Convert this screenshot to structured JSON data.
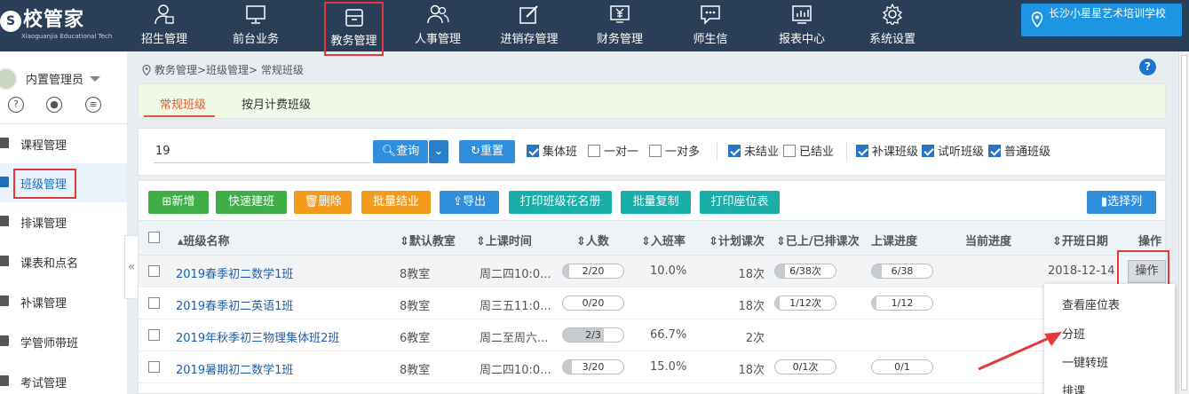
{
  "brand": {
    "name": "校管家",
    "sub": "Xiaoguanjia Educational Tech"
  },
  "nav": [
    {
      "label": "招生管理",
      "icon": "recruit-icon"
    },
    {
      "label": "前台业务",
      "icon": "monitor-icon"
    },
    {
      "label": "教务管理",
      "icon": "archive-icon",
      "active": true
    },
    {
      "label": "人事管理",
      "icon": "people-icon"
    },
    {
      "label": "进销存管理",
      "icon": "edit-icon"
    },
    {
      "label": "财务管理",
      "icon": "finance-icon"
    },
    {
      "label": "师生信",
      "icon": "message-icon"
    },
    {
      "label": "报表中心",
      "icon": "chart-icon"
    },
    {
      "label": "系统设置",
      "icon": "gear-icon"
    }
  ],
  "school": "长沙小星星艺术培训学校",
  "user": {
    "name": "内置管理员"
  },
  "menu": [
    {
      "label": "课程管理",
      "icon": "book-icon"
    },
    {
      "label": "班级管理",
      "icon": "class-icon",
      "selected": true
    },
    {
      "label": "排课管理",
      "icon": "calendar-icon"
    },
    {
      "label": "课表和点名",
      "icon": "checklist-icon"
    },
    {
      "label": "补课管理",
      "icon": "makeup-icon"
    },
    {
      "label": "学管师带班",
      "icon": "teacher-icon"
    },
    {
      "label": "考试管理",
      "icon": "exam-icon"
    }
  ],
  "breadcrumb": "教务管理>班级管理> 常规班级",
  "tabs": [
    "常规班级",
    "按月计费班级"
  ],
  "search": {
    "value": "19",
    "query_label": "查询",
    "reset_label": "重置"
  },
  "filters": [
    {
      "label": "集体班",
      "checked": true
    },
    {
      "label": "一对一",
      "checked": false
    },
    {
      "label": "一对多",
      "checked": false
    },
    {
      "label": "未结业",
      "checked": true
    },
    {
      "label": "已结业",
      "checked": false
    },
    {
      "label": "补课班级",
      "checked": true
    },
    {
      "label": "试听班级",
      "checked": true
    },
    {
      "label": "普通班级",
      "checked": true
    }
  ],
  "actions": {
    "add": "新增",
    "quick": "快速建班",
    "delete": "删除",
    "graduate": "批量结业",
    "export": "导出",
    "print_roster": "打印班级花名册",
    "batch_copy": "批量复制",
    "print_seat": "打印座位表",
    "select_cols": "选择列"
  },
  "columns": [
    "班级名称",
    "默认教室",
    "上课时间",
    "人数",
    "入班率",
    "计划课次",
    "已上/已排课次",
    "上课进度",
    "当前进度",
    "开班日期",
    "操作"
  ],
  "rows": [
    {
      "name": "2019春季初二数学1班",
      "room": "8教室",
      "time": "周二四10:0...",
      "count": "2/20",
      "count_ratio": 0.1,
      "rate": "10.0%",
      "plan": "18次",
      "done": "6/38次",
      "done_ratio": 0.16,
      "progress": "6/38",
      "progress_ratio": 0.16,
      "date": "2018-12-14",
      "op": "操作"
    },
    {
      "name": "2019春季初二英语1班",
      "room": "8教室",
      "time": "周三五11:0...",
      "count": "0/20",
      "count_ratio": 0,
      "rate": "",
      "plan": "18次",
      "done": "1/12次",
      "done_ratio": 0.08,
      "progress": "1/12",
      "progress_ratio": 0.08,
      "date": "",
      "op": ""
    },
    {
      "name": "2019年秋季初三物理集体班2班",
      "room": "6教室",
      "time": "周二至周六...",
      "count": "2/3",
      "count_ratio": 0.67,
      "rate": "66.7%",
      "plan": "2次",
      "done": "",
      "done_ratio": 0,
      "progress": "",
      "progress_ratio": 0,
      "date": "",
      "op": ""
    },
    {
      "name": "2019暑期初二数学1班",
      "room": "8教室",
      "time": "周二四10:0...",
      "count": "3/20",
      "count_ratio": 0.15,
      "rate": "15.0%",
      "plan": "18次",
      "done": "0/1次",
      "done_ratio": 0,
      "progress": "0/1",
      "progress_ratio": 0,
      "date": "",
      "op": ""
    }
  ],
  "dropdown": [
    "查看座位表",
    "分班",
    "一键转班",
    "排课"
  ],
  "colors": {
    "topbar": "#2b3e57",
    "accent": "#1d95e3",
    "highlight": "#e4393c"
  }
}
